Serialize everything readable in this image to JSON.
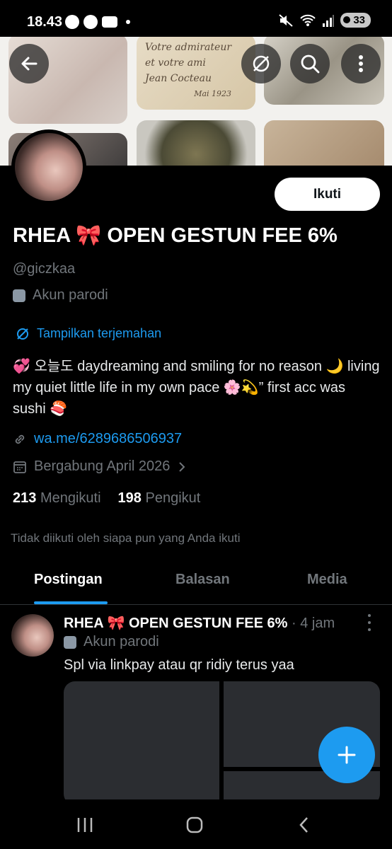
{
  "status_bar": {
    "time": "18.43",
    "battery": "33"
  },
  "profile": {
    "display_name": "RHEA 🎀 OPEN GESTUN FEE 6%",
    "handle": "@giczkaa",
    "parody_label": "Akun parodi",
    "translate_label": "Tampilkan terjemahan",
    "bio": "💞 오늘도 daydreaming and smiling for no reason 🌙 living my quiet little life in my own pace 🌸💫” first acc was sushi 🍣",
    "link": "wa.me/6289686506937",
    "joined": "Bergabung April 2026",
    "following_count": "213",
    "following_label": "Mengikuti",
    "followers_count": "198",
    "followers_label": "Pengikut",
    "not_followed_text": "Tidak diikuti oleh siapa pun yang Anda ikuti",
    "follow_button": "Ikuti"
  },
  "banner_text": {
    "line1": "Votre admirateur",
    "line2": "et votre ami",
    "line3": "Jean Cocteau",
    "line4": "Mai 1923"
  },
  "tabs": [
    {
      "label": "Postingan",
      "active": true
    },
    {
      "label": "Balasan",
      "active": false
    },
    {
      "label": "Media",
      "active": false
    }
  ],
  "post": {
    "author": "RHEA 🎀 OPEN GESTUN FEE 6%",
    "time": "· 4 jam",
    "parody_label": "Akun parodi",
    "text": "Spl via linkpay atau qr ridiy terus yaa"
  },
  "colors": {
    "accent": "#1d9bf0",
    "background": "#000000",
    "muted": "#71767b"
  },
  "icons": [
    "back-arrow-icon",
    "no-translate-icon",
    "search-icon",
    "more-vertical-icon",
    "mask-icon",
    "link-icon",
    "calendar-icon",
    "plus-icon"
  ]
}
